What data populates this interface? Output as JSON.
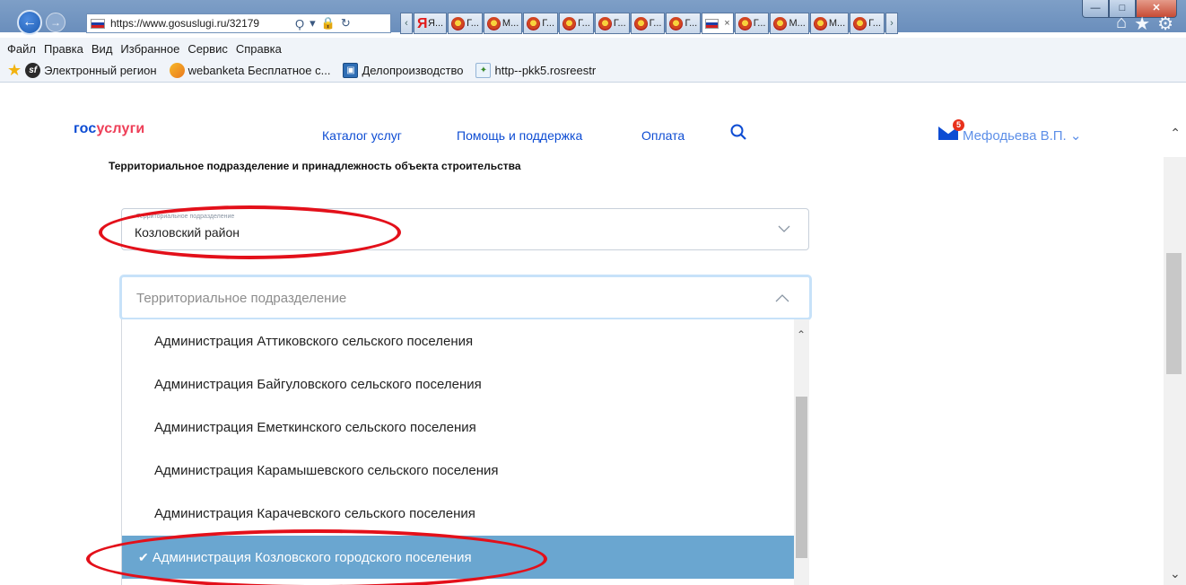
{
  "window": {
    "title": "",
    "controls": {
      "minimize": "—",
      "maximize": "□",
      "close": "✕"
    }
  },
  "navigation": {
    "back": "←",
    "forward": "→",
    "address_url": "https://www.gosuslugi.ru/32179",
    "address_tools": [
      "Ϙ",
      "▾",
      "🔒",
      "↻"
    ],
    "tabs": [
      {
        "icon": "yandex-icon",
        "label": "Я..."
      },
      {
        "icon": "emblem-icon",
        "label": "Г..."
      },
      {
        "icon": "emblem-icon",
        "label": "М..."
      },
      {
        "icon": "emblem-icon",
        "label": "Г..."
      },
      {
        "icon": "emblem-icon",
        "label": "Г..."
      },
      {
        "icon": "emblem-icon",
        "label": "Г..."
      },
      {
        "icon": "emblem-icon",
        "label": "Г..."
      },
      {
        "icon": "emblem-icon",
        "label": "Г..."
      },
      {
        "icon": "flag-icon",
        "label": "",
        "close": "×"
      },
      {
        "icon": "emblem-icon",
        "label": "Г..."
      },
      {
        "icon": "emblem-icon",
        "label": "М..."
      },
      {
        "icon": "emblem-icon",
        "label": "М..."
      },
      {
        "icon": "emblem-icon",
        "label": "Г..."
      }
    ],
    "right_icons": [
      "home-icon",
      "star-icon",
      "gear-icon"
    ]
  },
  "menubar": [
    "Файл",
    "Правка",
    "Вид",
    "Избранное",
    "Сервис",
    "Справка"
  ],
  "favorites": [
    {
      "icon": "symfony-icon",
      "label": "Электронный регион"
    },
    {
      "icon": "webanketa-icon",
      "label": "webanketa Бесплатное с..."
    },
    {
      "icon": "document-icon",
      "label": "Делопроизводство"
    },
    {
      "icon": "pkk-icon",
      "label": "http--pkk5.rosreestr"
    }
  ],
  "header": {
    "logo_part1": "гос",
    "logo_part2": "услуги",
    "nav": [
      "Каталог услуг",
      "Помощь и поддержка",
      "Оплата"
    ],
    "mail_count": "5",
    "user": "Мефодьева В.П."
  },
  "form": {
    "section_title": "Территориальное подразделение и принадлежность объекта строительства",
    "select1": {
      "label": "Территориальное подразделение",
      "value": "Козловский район"
    },
    "select2": {
      "placeholder": "Территориальное подразделение",
      "options": [
        "Администрация Аттиковского сельского поселения",
        "Администрация Байгуловского сельского поселения",
        "Администрация Еметкинского сельского поселения",
        "Администрация Карамышевского сельского поселения",
        "Администрация Карачевского сельского поселения",
        "Администрация Козловского городского поселения"
      ],
      "selected_index": 5
    }
  },
  "colors": {
    "brand_blue": "#0d4cd3",
    "brand_red": "#ee3f58",
    "selected_bg": "#6aa6d0",
    "annotation_red": "#e3101a"
  }
}
